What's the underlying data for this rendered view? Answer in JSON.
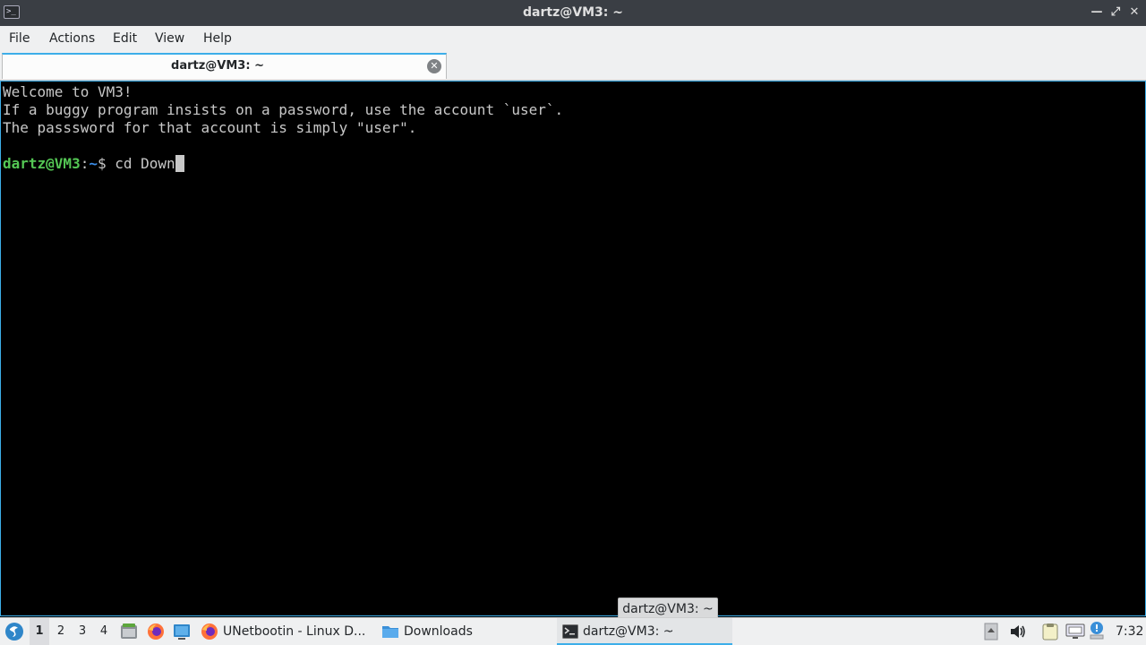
{
  "window": {
    "title": "dartz@VM3: ~",
    "app_icon_text": ">_",
    "minimize_glyph": "—",
    "maximize_glyph": "⤢",
    "close_glyph": "✕"
  },
  "menu": {
    "items": [
      "File",
      "Actions",
      "Edit",
      "View",
      "Help"
    ]
  },
  "tabs": [
    {
      "label": "dartz@VM3: ~",
      "close_glyph": "✕"
    }
  ],
  "terminal": {
    "lines": [
      "Welcome to VM3!",
      "If a buggy program insists on a password, use the account `user`.",
      "The passsword for that account is simply \"user\"."
    ],
    "prompt": {
      "user_host": "dartz@VM3",
      "sep": ":",
      "path": "~",
      "symbol": "$ ",
      "command": "cd Down"
    }
  },
  "taskbar": {
    "workspaces": [
      "1",
      "2",
      "3",
      "4"
    ],
    "active_workspace": "1",
    "tasks": [
      {
        "label": "UNetbootin - Linux D...",
        "icon": "firefox-icon"
      },
      {
        "label": "Downloads",
        "icon": "folder-icon"
      },
      {
        "label": "dartz@VM3: ~",
        "icon": "terminal-icon"
      }
    ],
    "tooltip": "dartz@VM3: ~",
    "clock": "7:32"
  },
  "colors": {
    "accent": "#3daee9",
    "prompt_user": "#54c754",
    "prompt_path": "#3b8eea",
    "terminal_bg": "#000000",
    "terminal_fg": "#c8c8c8"
  }
}
